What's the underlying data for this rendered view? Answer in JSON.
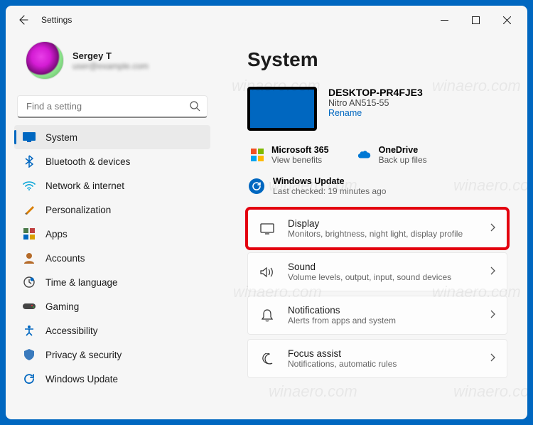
{
  "window": {
    "title": "Settings"
  },
  "profile": {
    "name": "Sergey T",
    "email": "user@example.com"
  },
  "search": {
    "placeholder": "Find a setting"
  },
  "sidebar": {
    "items": [
      {
        "label": "System",
        "icon": "monitor-icon",
        "active": true
      },
      {
        "label": "Bluetooth & devices",
        "icon": "bluetooth-icon"
      },
      {
        "label": "Network & internet",
        "icon": "wifi-icon"
      },
      {
        "label": "Personalization",
        "icon": "paint-icon"
      },
      {
        "label": "Apps",
        "icon": "apps-icon"
      },
      {
        "label": "Accounts",
        "icon": "person-icon"
      },
      {
        "label": "Time & language",
        "icon": "clock-icon"
      },
      {
        "label": "Gaming",
        "icon": "gamepad-icon"
      },
      {
        "label": "Accessibility",
        "icon": "accessibility-icon"
      },
      {
        "label": "Privacy & security",
        "icon": "shield-icon"
      },
      {
        "label": "Windows Update",
        "icon": "update-icon"
      }
    ]
  },
  "page": {
    "title": "System"
  },
  "device": {
    "name": "DESKTOP-PR4FJE3",
    "model": "Nitro AN515-55",
    "rename": "Rename"
  },
  "services": {
    "m365": {
      "label": "Microsoft 365",
      "sub": "View benefits"
    },
    "onedrive": {
      "label": "OneDrive",
      "sub": "Back up files"
    }
  },
  "update": {
    "label": "Windows Update",
    "sub": "Last checked: 19 minutes ago"
  },
  "cards": [
    {
      "title": "Display",
      "sub": "Monitors, brightness, night light, display profile",
      "icon": "display-icon",
      "highlighted": true
    },
    {
      "title": "Sound",
      "sub": "Volume levels, output, input, sound devices",
      "icon": "sound-icon"
    },
    {
      "title": "Notifications",
      "sub": "Alerts from apps and system",
      "icon": "bell-icon"
    },
    {
      "title": "Focus assist",
      "sub": "Notifications, automatic rules",
      "icon": "moon-icon"
    }
  ],
  "watermark": "winaero.com"
}
